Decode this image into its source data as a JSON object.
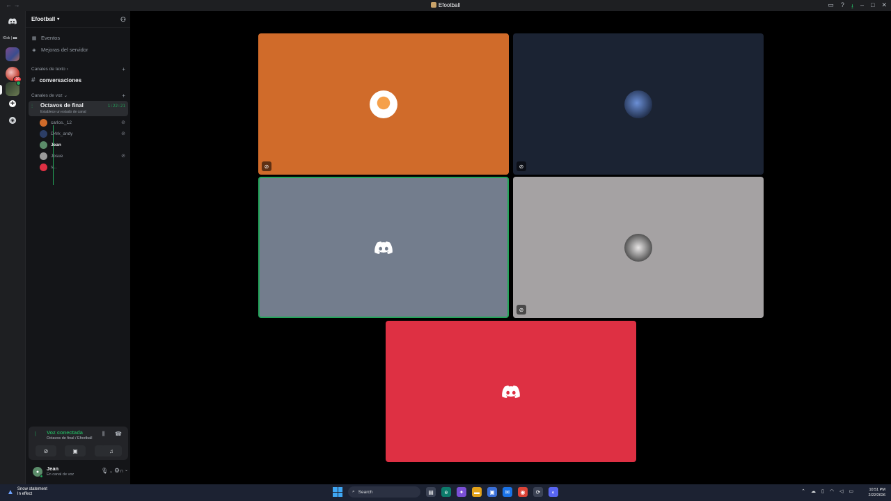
{
  "window": {
    "title": "Efootball",
    "nav": "← →"
  },
  "guilds": {
    "label": "IOsk | ■■",
    "badge_count": "36"
  },
  "server": {
    "name": "Efootball",
    "menu": [
      {
        "label": "Eventos",
        "icon": "calendar-icon"
      },
      {
        "label": "Mejoras del servidor",
        "icon": "boost-icon"
      }
    ],
    "text_category": "Canales de texto",
    "text_channel": "conversaciones",
    "voice_category": "Canales de voz",
    "voice_channel": {
      "name": "Octavos de final",
      "status": "Establece un estado de canal",
      "timer": "1:22:21"
    },
    "voice_users": [
      {
        "name": "carlos._12",
        "muted": true,
        "color": "#d06b2a"
      },
      {
        "name": "D4rk_andy",
        "muted": true,
        "color": "#2c3e66"
      },
      {
        "name": "Jean",
        "muted": false,
        "color": "#5b8c6a"
      },
      {
        "name": "Josue",
        "muted": true,
        "color": "#9a9a9a"
      },
      {
        "name": "s...",
        "muted": false,
        "color": "#de3043"
      }
    ]
  },
  "voice_panel": {
    "status": "Voz conectada",
    "location": "Octavos de final / Efootball"
  },
  "user": {
    "name": "Jean",
    "status": "En canal de voz"
  },
  "tiles": [
    {
      "user": "carlos._12",
      "bg": "#d06b2a",
      "muted": true
    },
    {
      "user": "D4rk_andy",
      "bg": "#1b2333",
      "muted": true
    },
    {
      "user": "Jean",
      "bg": "#737d8d",
      "muted": false,
      "speaking": true
    },
    {
      "user": "Josue",
      "bg": "#a5a2a3",
      "muted": true
    },
    {
      "user": "s...",
      "bg": "#de3043",
      "muted": false
    }
  ],
  "taskbar": {
    "weather_title": "Snow statement",
    "weather_sub": "In effect",
    "search_placeholder": "Search",
    "time": "10:51 PM",
    "date": "2/22/2026"
  }
}
